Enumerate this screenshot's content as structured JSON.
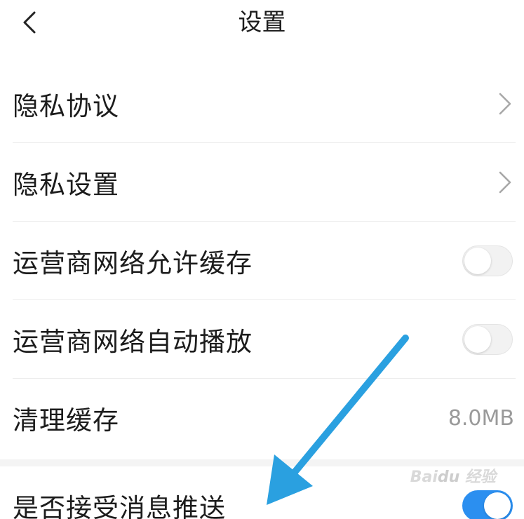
{
  "header": {
    "title": "设置",
    "back_icon": "chevron-left-icon"
  },
  "settings": [
    {
      "label": "隐私协议",
      "control": "chevron",
      "icon": "chevron-right-icon"
    },
    {
      "label": "隐私设置",
      "control": "chevron",
      "icon": "chevron-right-icon"
    },
    {
      "label": "运营商网络允许缓存",
      "control": "toggle",
      "state": "off"
    },
    {
      "label": "运营商网络自动播放",
      "control": "toggle",
      "state": "off"
    },
    {
      "label": "清理缓存",
      "control": "value",
      "value": "8.0MB"
    },
    {
      "label": "是否接受消息推送",
      "control": "toggle",
      "state": "on"
    }
  ],
  "annotation": {
    "arrow_color": "#2aa0e0",
    "points_to": "是否接受消息推送"
  },
  "watermark": "Baidu经验",
  "colors": {
    "accent_toggle_on": "#2b8ff0",
    "divider": "#ececec",
    "secondary_text": "#9a9a9a"
  }
}
